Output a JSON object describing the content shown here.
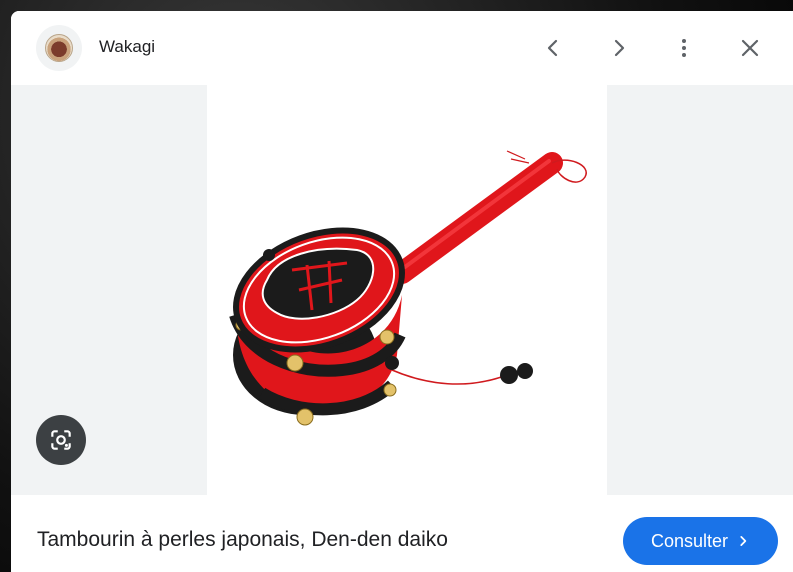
{
  "header": {
    "source_name": "Wakagi",
    "prev_icon": "chevron-left-icon",
    "next_icon": "chevron-right-icon",
    "more_icon": "more-vert-icon",
    "close_icon": "close-icon"
  },
  "footer": {
    "caption": "Tambourin à perles japonais, Den-den daiko",
    "visit_label": "Consulter",
    "visit_icon": "chevron-right-icon"
  },
  "colors": {
    "accent": "#1a73e8",
    "icon": "#5f6368",
    "drum_red": "#e0161b"
  }
}
